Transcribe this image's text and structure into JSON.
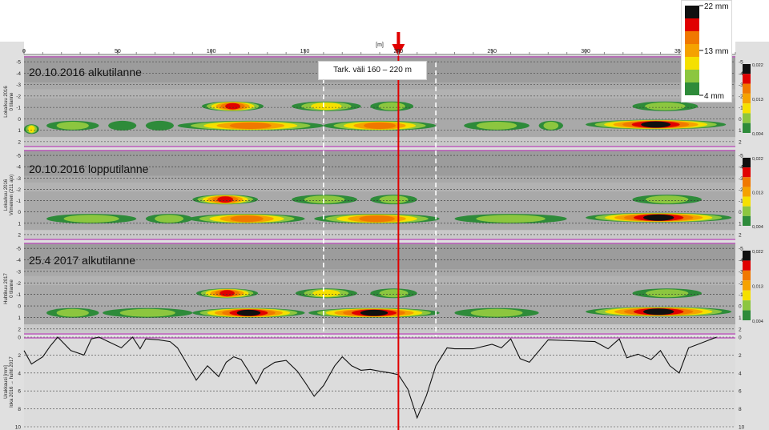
{
  "x_unit_label": "[m]",
  "x_ticks": [
    0,
    50,
    100,
    150,
    200,
    250,
    300,
    350
  ],
  "range_annotation": "Tark. väli 160 – 220 m",
  "colors": {
    "c4": "#2e8b3a",
    "c7": "#8cc63f",
    "c10": "#f5e000",
    "c13": "#f5a200",
    "c16": "#f07800",
    "c19": "#e00000",
    "c22": "#101010",
    "panel_bg": "#a9a9a9",
    "line_red": "#e00000"
  },
  "legend_top": {
    "labels": [
      "22 mm",
      "13 mm",
      "4 mm"
    ],
    "swatches": [
      "#101010",
      "#e00000",
      "#f07800",
      "#f5a200",
      "#f5e000",
      "#8cc63f",
      "#2e8b3a"
    ]
  },
  "legend_side": {
    "labels": [
      "0,022",
      "0,013",
      "0,004"
    ]
  },
  "panels": [
    {
      "title": "20.10.2016 alkutilanne",
      "ylabel_lines": [
        "Loka/kuu 2016",
        "0 tilanne"
      ],
      "y_ticks": [
        -5,
        -4,
        -3,
        -2,
        -1,
        0,
        1,
        2
      ]
    },
    {
      "title": "20.10.2016 lopputilanne",
      "ylabel_lines": [
        "Loka/kuu 2016",
        "Viimeinen (211 ajo)"
      ],
      "y_ticks": [
        -5,
        -4,
        -3,
        -2,
        -1,
        0,
        1,
        2
      ]
    },
    {
      "title": "25.4 2017 alkutilanne",
      "ylabel_lines": [
        "Huhtikuu 2017",
        "0 tilanne"
      ],
      "y_ticks": [
        -5,
        -4,
        -3,
        -2,
        -1,
        0,
        1,
        2
      ]
    }
  ],
  "bottom_chart": {
    "ylabel_lines": [
      "Urakkausi [mm]",
      "loka 2016 → huhti 2017"
    ],
    "y_ticks": [
      0,
      2,
      4,
      6,
      8,
      10
    ]
  },
  "chart_data": {
    "type": "heatmap",
    "x_range": [
      0,
      380
    ],
    "y_range": [
      -5.5,
      2.5
    ],
    "color_scale": {
      "min": 4,
      "mid": 13,
      "max": 22,
      "unit": "mm"
    },
    "marker_x": 200,
    "range_x": [
      160,
      220
    ],
    "panels": [
      {
        "blobs": [
          {
            "x1": 95,
            "x2": 128,
            "y": -1.1,
            "peak": 20
          },
          {
            "x1": 143,
            "x2": 180,
            "y": -1.1,
            "peak": 10
          },
          {
            "x1": 185,
            "x2": 208,
            "y": -1.1,
            "peak": 9
          },
          {
            "x1": 0,
            "x2": 8,
            "y": 0.9,
            "peak": 12
          },
          {
            "x1": 12,
            "x2": 40,
            "y": 0.6,
            "peak": 8
          },
          {
            "x1": 45,
            "x2": 60,
            "y": 0.6,
            "peak": 6
          },
          {
            "x1": 65,
            "x2": 80,
            "y": 0.6,
            "peak": 6
          },
          {
            "x1": 82,
            "x2": 160,
            "y": 0.6,
            "peak": 17
          },
          {
            "x1": 160,
            "x2": 220,
            "y": 0.6,
            "peak": 16
          },
          {
            "x1": 235,
            "x2": 270,
            "y": 0.6,
            "peak": 8
          },
          {
            "x1": 275,
            "x2": 288,
            "y": 0.6,
            "peak": 7
          },
          {
            "x1": 300,
            "x2": 375,
            "y": 0.5,
            "peak": 22
          },
          {
            "x1": 325,
            "x2": 360,
            "y": -1.1,
            "peak": 8
          }
        ]
      },
      {
        "blobs": [
          {
            "x1": 90,
            "x2": 125,
            "y": -1.1,
            "peak": 20
          },
          {
            "x1": 143,
            "x2": 178,
            "y": -1.1,
            "peak": 9
          },
          {
            "x1": 185,
            "x2": 210,
            "y": -1.1,
            "peak": 9
          },
          {
            "x1": 12,
            "x2": 60,
            "y": 0.6,
            "peak": 8
          },
          {
            "x1": 65,
            "x2": 90,
            "y": 0.6,
            "peak": 7
          },
          {
            "x1": 88,
            "x2": 150,
            "y": 0.6,
            "peak": 18
          },
          {
            "x1": 155,
            "x2": 222,
            "y": 0.6,
            "peak": 18
          },
          {
            "x1": 230,
            "x2": 290,
            "y": 0.6,
            "peak": 8
          },
          {
            "x1": 300,
            "x2": 378,
            "y": 0.5,
            "peak": 22
          },
          {
            "x1": 325,
            "x2": 362,
            "y": -1.1,
            "peak": 8
          }
        ]
      },
      {
        "blobs": [
          {
            "x1": 92,
            "x2": 125,
            "y": -1.1,
            "peak": 19
          },
          {
            "x1": 145,
            "x2": 178,
            "y": -1.1,
            "peak": 10
          },
          {
            "x1": 185,
            "x2": 210,
            "y": -1.1,
            "peak": 9
          },
          {
            "x1": 12,
            "x2": 40,
            "y": 0.6,
            "peak": 7
          },
          {
            "x1": 42,
            "x2": 90,
            "y": 0.6,
            "peak": 8
          },
          {
            "x1": 90,
            "x2": 150,
            "y": 0.6,
            "peak": 22
          },
          {
            "x1": 152,
            "x2": 222,
            "y": 0.6,
            "peak": 22
          },
          {
            "x1": 230,
            "x2": 275,
            "y": 0.6,
            "peak": 8
          },
          {
            "x1": 300,
            "x2": 378,
            "y": 0.5,
            "peak": 22
          },
          {
            "x1": 325,
            "x2": 362,
            "y": -1.1,
            "peak": 8
          }
        ]
      }
    ],
    "bottom_line": {
      "x": [
        0,
        4,
        10,
        14,
        18,
        25,
        32,
        36,
        40,
        45,
        52,
        58,
        62,
        65,
        72,
        78,
        82,
        88,
        92,
        98,
        104,
        108,
        112,
        116,
        120,
        124,
        128,
        134,
        140,
        146,
        150,
        155,
        160,
        166,
        170,
        175,
        180,
        185,
        190,
        196,
        200,
        205,
        210,
        215,
        220,
        226,
        230,
        240,
        250,
        255,
        260,
        265,
        270,
        280,
        292,
        305,
        312,
        318,
        322,
        328,
        335,
        340,
        345,
        350,
        355,
        360,
        365,
        370
      ],
      "y": [
        1.5,
        3,
        2.2,
        1,
        0,
        1.5,
        2,
        0.2,
        0,
        0.5,
        1.2,
        0,
        1.3,
        0.2,
        0.3,
        0.5,
        1.2,
        3.3,
        4.8,
        3.2,
        4.4,
        2.8,
        2.2,
        2.5,
        3.8,
        5.2,
        3.6,
        2.8,
        2.6,
        3.8,
        5,
        6.6,
        5.4,
        3.2,
        2.2,
        3.2,
        3.7,
        3.6,
        3.8,
        4,
        4.2,
        5.8,
        9,
        6.5,
        3.2,
        1.2,
        1.3,
        1.3,
        0.8,
        1.2,
        0.2,
        2.4,
        2.8,
        0.3,
        0.4,
        0.5,
        1.3,
        0.2,
        2.3,
        1.9,
        2.5,
        1.5,
        3.2,
        4,
        1.2,
        0.8,
        0.4,
        0
      ]
    }
  }
}
